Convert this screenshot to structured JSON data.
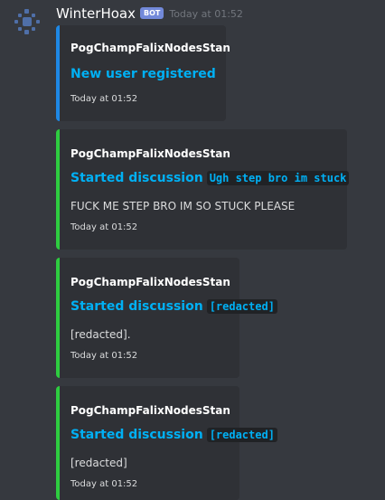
{
  "message": {
    "author": "WinterHoax",
    "bot_tag": "BOT",
    "timestamp": "Today at 01:52",
    "avatar_icon": "discord-default-avatar-icon"
  },
  "colors": {
    "background": "#36393f",
    "embed_background": "#2f3136",
    "title_link": "#00b0f4",
    "bar_blue": "#1e88e5",
    "bar_green": "#2ecc40",
    "bot_tag": "#7289da"
  },
  "embeds": [
    {
      "author": "PogChampFalixNodesStan",
      "title": "New user registered",
      "title_code": "",
      "description": "",
      "footer": "Today at 01:52",
      "bar_color": "#1e88e5"
    },
    {
      "author": "PogChampFalixNodesStan",
      "title": "Started discussion",
      "title_code": "Ugh step bro im stuck",
      "description": "FUCK ME STEP BRO IM SO STUCK PLEASE",
      "footer": "Today at 01:52",
      "bar_color": "#2ecc40"
    },
    {
      "author": "PogChampFalixNodesStan",
      "title": "Started discussion",
      "title_code": "[redacted]",
      "description": "[redacted].",
      "footer": "Today at 01:52",
      "bar_color": "#2ecc40"
    },
    {
      "author": "PogChampFalixNodesStan",
      "title": "Started discussion",
      "title_code": "[redacted]",
      "description": "[redacted]",
      "footer": "Today at 01:52",
      "bar_color": "#2ecc40"
    }
  ]
}
